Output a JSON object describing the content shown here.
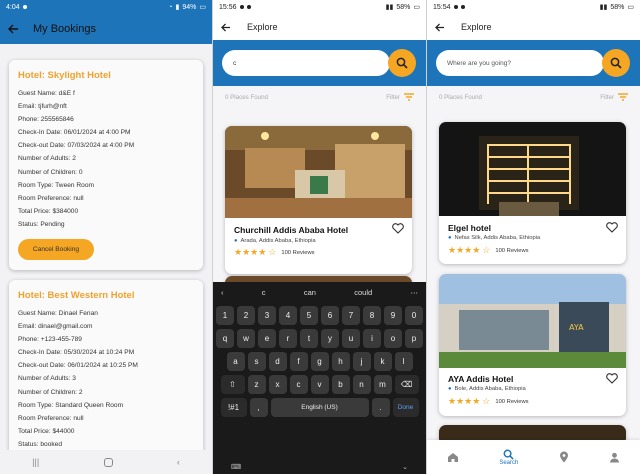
{
  "colors": {
    "brand_blue": "#1e74b9",
    "accent_orange": "#f5a623",
    "title_orange": "#f0a22e"
  },
  "screen1": {
    "status": {
      "time": "4:04",
      "battery": "94%"
    },
    "title": "My Bookings",
    "bookings": [
      {
        "hotel": "Hotel: Skylight Hotel",
        "lines": [
          "Guest Name: d&E f",
          "Email: tjfurh@nft",
          "Phone: 255565846",
          "Check-In Date: 06/01/2024 at 4:00 PM",
          "Check-out Date: 07/03/2024 at 4:00 PM",
          "Number of Adults: 2",
          "Number of Children: 0",
          "Room Type: Tween Room",
          "Room Preference: null",
          "Total Price: $384000",
          "Status: Pending"
        ],
        "cancel_label": "Cancel Booking"
      },
      {
        "hotel": "Hotel: Best Western Hotel",
        "lines": [
          "Guest Name: Dinael Fenan",
          "Email: dinael@gmail.com",
          "Phone: +123-455-789",
          "Check-In Date: 05/30/2024 at 10:24 PM",
          "Check-out Date: 06/01/2024 at 10:25 PM",
          "Number of Adults: 3",
          "Number of Children: 2",
          "Room Type: Standard Queen Room",
          "Room Preference: null",
          "Total Price: $44000",
          "Status: booked"
        ]
      }
    ]
  },
  "screen2": {
    "status": {
      "time": "15:56",
      "battery": "58%"
    },
    "title": "Explore",
    "search_value": "c",
    "places_found": "0 Places Found",
    "filter_label": "Filter",
    "hotels": [
      {
        "name": "Churchill Addis Ababa Hotel",
        "location": "Arada, Addis Ababa, Ethiopia",
        "rating": 4,
        "reviews": "100 Reviews"
      }
    ],
    "keyboard": {
      "suggestions": [
        "c",
        "can",
        "could"
      ],
      "numbers": [
        "1",
        "2",
        "3",
        "4",
        "5",
        "6",
        "7",
        "8",
        "9",
        "0"
      ],
      "row1": [
        "q",
        "w",
        "e",
        "r",
        "t",
        "y",
        "u",
        "i",
        "o",
        "p"
      ],
      "row2": [
        "a",
        "s",
        "d",
        "f",
        "g",
        "h",
        "j",
        "k",
        "l"
      ],
      "row3": [
        "z",
        "x",
        "c",
        "v",
        "b",
        "n",
        "m"
      ],
      "sym_label": "!#1",
      "comma": ",",
      "space_label": "English (US)",
      "period": ".",
      "done_label": "Done"
    }
  },
  "screen3": {
    "status": {
      "time": "15:54",
      "battery": "58%"
    },
    "title": "Explore",
    "search_placeholder": "Where are you going?",
    "places_found": "0 Places Found",
    "filter_label": "Filter",
    "hotels": [
      {
        "name": "Elgel hotel",
        "location": "Nefas Silk, Addis Ababa, Ethiopia",
        "rating": 4,
        "reviews": "100 Reviews"
      },
      {
        "name": "AYA Addis Hotel",
        "location": "Bole, Addis Ababa, Ethiopia",
        "rating": 4,
        "reviews": "100 Reviews"
      }
    ],
    "nav": {
      "search_label": "Search"
    }
  }
}
